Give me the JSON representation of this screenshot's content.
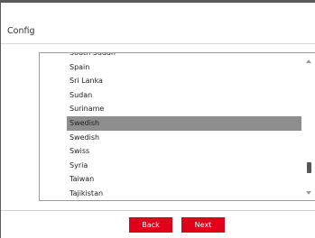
{
  "dialog": {
    "title": "Config"
  },
  "list": {
    "items": [
      "South Sudan",
      "Spain",
      "Sri Lanka",
      "Sudan",
      "Suriname",
      "Swedish",
      "Swedish",
      "Swiss",
      "Syria",
      "Taiwan",
      "Tajikistan"
    ],
    "selected_index": 5
  },
  "buttons": {
    "back": "Back",
    "next": "Next"
  },
  "colors": {
    "accent": "#e0001b",
    "selection": "#8e8e8e"
  },
  "icons": {
    "scroll_up": "chevron-up-icon",
    "scroll_down": "chevron-down-icon"
  }
}
